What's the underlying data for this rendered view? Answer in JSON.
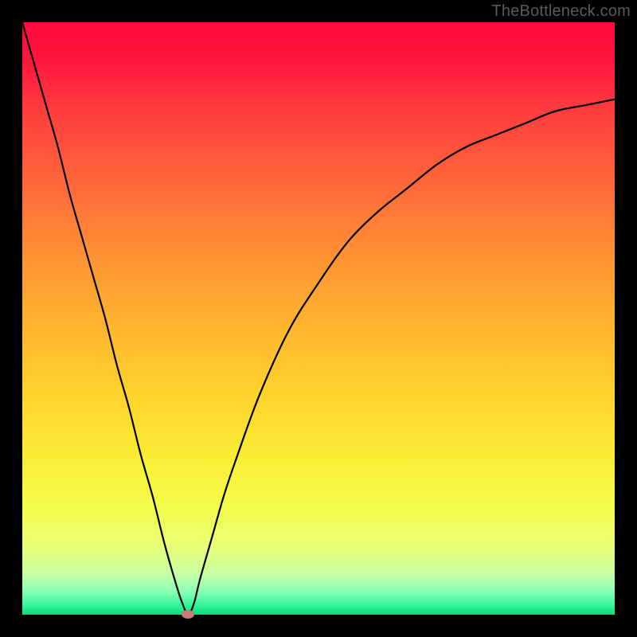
{
  "watermark": "TheBottleneck.com",
  "chart_data": {
    "type": "line",
    "title": "",
    "xlabel": "",
    "ylabel": "",
    "xlim": [
      0,
      100
    ],
    "ylim": [
      0,
      100
    ],
    "grid": false,
    "background_gradient": {
      "direction": "vertical",
      "stops": [
        {
          "pos": 0.0,
          "color": "#ff0a3a"
        },
        {
          "pos": 0.28,
          "color": "#ff6a3a"
        },
        {
          "pos": 0.64,
          "color": "#ffd62d"
        },
        {
          "pos": 0.88,
          "color": "#eaff73"
        },
        {
          "pos": 1.0,
          "color": "#0ad97a"
        }
      ]
    },
    "series": [
      {
        "name": "bottleneck-curve",
        "color": "#000000",
        "x": [
          0,
          2,
          4,
          6,
          8,
          10,
          12,
          14,
          16,
          18,
          20,
          22,
          24,
          26,
          27,
          28,
          29,
          30,
          32,
          34,
          36,
          40,
          45,
          50,
          55,
          60,
          65,
          70,
          75,
          80,
          85,
          90,
          95,
          100
        ],
        "y": [
          100,
          93,
          86,
          79,
          71,
          64,
          57,
          50,
          42,
          35,
          27,
          20,
          12,
          5,
          2,
          0,
          2,
          6,
          13,
          20,
          26,
          37,
          48,
          56,
          63,
          68,
          72,
          76,
          79,
          81,
          83,
          85,
          86,
          87
        ]
      }
    ],
    "minimum_marker": {
      "x": 28,
      "y": 0,
      "color": "#c77a76"
    },
    "annotations": []
  }
}
